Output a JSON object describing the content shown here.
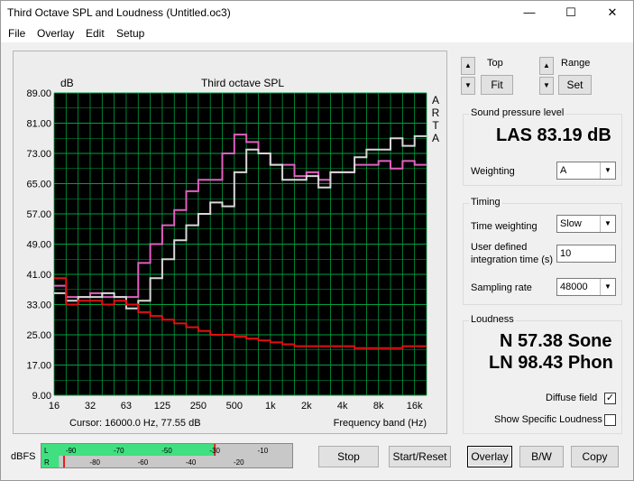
{
  "window": {
    "title": "Third Octave SPL and Loudness (Untitled.oc3)",
    "minimize": "—",
    "maximize": "☐",
    "close": "✕"
  },
  "menu": [
    "File",
    "Overlay",
    "Edit",
    "Setup"
  ],
  "plot": {
    "y_unit": "dB",
    "title": "Third octave SPL",
    "brand": [
      "A",
      "R",
      "T",
      "A"
    ],
    "cursor": "Cursor: 16000.0 Hz, 77.55 dB",
    "xlabel": "Frequency band (Hz)",
    "yticks": [
      "89.00",
      "81.00",
      "73.00",
      "65.00",
      "57.00",
      "49.00",
      "41.00",
      "33.00",
      "25.00",
      "17.00",
      "9.00"
    ],
    "xticks": [
      "16",
      "32",
      "63",
      "125",
      "250",
      "500",
      "1k",
      "2k",
      "4k",
      "8k",
      "16k"
    ]
  },
  "chart_data": {
    "type": "line",
    "title": "Third octave SPL",
    "ylabel": "dB",
    "xlabel": "Frequency band (Hz)",
    "ylim": [
      9,
      89
    ],
    "x_scale": "log (third-octave bands)",
    "x": [
      16,
      20,
      25,
      31.5,
      40,
      50,
      63,
      80,
      100,
      125,
      160,
      200,
      250,
      315,
      400,
      500,
      630,
      800,
      1000,
      1250,
      1600,
      2000,
      2500,
      3150,
      4000,
      5000,
      6300,
      8000,
      10000,
      12500,
      16000
    ],
    "grid": true,
    "series": [
      {
        "color": "#e060c0",
        "values": [
          38,
          35,
          35,
          36,
          35,
          35,
          35,
          44,
          49,
          54,
          58,
          63,
          66,
          66,
          73,
          78,
          76,
          73,
          70,
          70,
          67,
          68,
          66,
          68,
          68,
          70,
          70,
          71,
          69,
          71,
          70
        ]
      },
      {
        "color": "#d8d8d8",
        "values": [
          36,
          34,
          35,
          35,
          36,
          35,
          32,
          34,
          40,
          45,
          50,
          54,
          57,
          60,
          59,
          68,
          74,
          73,
          70,
          66,
          66,
          67,
          64,
          68,
          68,
          72,
          74,
          74,
          77,
          75,
          77.55
        ]
      },
      {
        "color": "#e01010",
        "values": [
          40,
          33,
          34,
          34,
          33,
          34,
          33,
          31,
          30,
          29,
          28,
          27,
          26,
          25,
          25,
          24.5,
          24,
          23.5,
          23,
          22.5,
          22,
          22,
          22,
          22,
          22,
          21.5,
          21.5,
          21.5,
          21.5,
          22,
          22
        ]
      }
    ]
  },
  "controls": {
    "up": "▲",
    "down": "▼",
    "top_label": "Top",
    "fit_label": "Fit",
    "range_label": "Range",
    "set_label": "Set"
  },
  "spl": {
    "group_title": "Sound pressure level",
    "readout": "LAS 83.19 dB",
    "weighting_label": "Weighting",
    "weighting_value": "A"
  },
  "timing": {
    "group_title": "Timing",
    "time_weighting_label": "Time weighting",
    "time_weighting_value": "Slow",
    "integration_label_1": "User defined",
    "integration_label_2": "integration time (s)",
    "integration_value": "10",
    "sampling_label": "Sampling rate",
    "sampling_value": "48000"
  },
  "loudness": {
    "group_title": "Loudness",
    "n_readout": "N 57.38 Sone",
    "ln_readout": "LN 98.43 Phon",
    "diffuse_label": "Diffuse field",
    "diffuse_checked": "✓",
    "specific_label": "Show Specific Loudness"
  },
  "meter": {
    "label": "dBFS",
    "scale": [
      "-90",
      "-80",
      "-70",
      "-60",
      "-50",
      "-40",
      "-30",
      "-20",
      "-10",
      "0"
    ],
    "channel_l": "L",
    "channel_r": "R",
    "level_l_dbfs": -30,
    "level_r_dbfs": -95
  },
  "bottom_buttons": {
    "stop": "Stop",
    "start_reset": "Start/Reset",
    "overlay": "Overlay",
    "bw": "B/W",
    "copy": "Copy"
  }
}
